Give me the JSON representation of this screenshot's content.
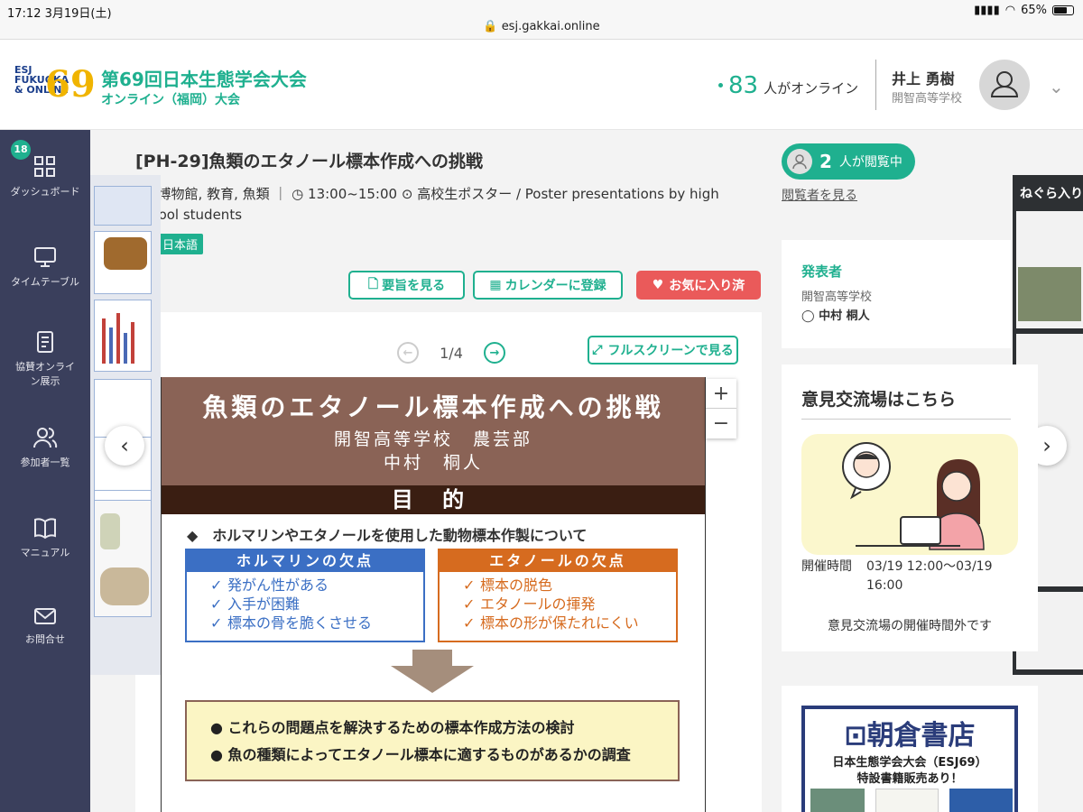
{
  "status_bar": {
    "time": "17:12",
    "date": "3月19日(土)",
    "url": "esj.gakkai.online",
    "battery": "65%"
  },
  "header": {
    "logo_top": "ESJ",
    "logo_mid": "FUKUOKA",
    "logo_bot": "& ONLINE",
    "logo_num": "69",
    "title": "第69回日本生態学会大会",
    "subtitle": "オンライン（福岡）大会",
    "online_count": "83",
    "online_label": "人がオンライン",
    "user_name": "井上 勇樹",
    "user_school": "開智高等学校"
  },
  "sidebar": {
    "badge": "18",
    "items": [
      {
        "label": "ダッシュボード",
        "icon": "grid-icon"
      },
      {
        "label": "タイムテーブル",
        "icon": "monitor-icon"
      },
      {
        "label": "協賛オンライン展示",
        "icon": "document-icon"
      },
      {
        "label": "参加者一覧",
        "icon": "users-icon"
      },
      {
        "label": "マニュアル",
        "icon": "book-icon"
      },
      {
        "label": "お問合せ",
        "icon": "mail-icon"
      }
    ]
  },
  "poster_info": {
    "title": "[PH-29]魚類のエタノール標本作成への挑戦",
    "keywords": "ト, 博物館, 教育, 魚類",
    "time": "13:00~15:00",
    "session": "高校生ポスター / Poster presentations by high school students",
    "lang": "日本語",
    "btn_abstract": "要旨を見る",
    "btn_calendar": "カレンダーに登録",
    "btn_fav": "お気に入り済",
    "page": "1/4",
    "btn_fullscreen": "フルスクリーンで見る"
  },
  "poster": {
    "title": "魚類のエタノール標本作成への挑戦",
    "school": "開智高等学校　農芸部",
    "author": "中村　桐人",
    "section": "目 的",
    "lead": "◆　ホルマリンやエタノールを使用した動物標本作製について",
    "box_left_title": "ホルマリンの欠点",
    "box_left_items": [
      "発がん性がある",
      "入手が困難",
      "標本の骨を脆くさせる"
    ],
    "box_right_title": "エタノールの欠点",
    "box_right_items": [
      "標本の脱色",
      "エタノールの揮発",
      "標本の形が保たれにくい"
    ],
    "goals": [
      "● これらの問題点を解決するための標本作成方法の検討",
      "● 魚の種類によってエタノール標本に適するものがあるかの調査"
    ]
  },
  "right_preview_title": "ねぐら入り",
  "viewers": {
    "count": "2",
    "label": "人が閲覧中",
    "link": "閲覧者を見る"
  },
  "presenter": {
    "heading": "発表者",
    "school": "開智高等学校",
    "name": "◯ 中村 桐人"
  },
  "exchange": {
    "heading": "意見交流場はこちら",
    "label": "開催時間",
    "time": "03/19 12:00〜03/19 16:00",
    "note": "意見交流場の開催時間外です"
  },
  "ad": {
    "brand": "朝倉書店",
    "line1": "日本生態学会大会（ESJ69）",
    "line2": "特設書籍販売あり！"
  },
  "colors": {
    "accent": "#1fb08f",
    "sidebar": "#3a3f5c",
    "fav": "#ea5a5a"
  }
}
